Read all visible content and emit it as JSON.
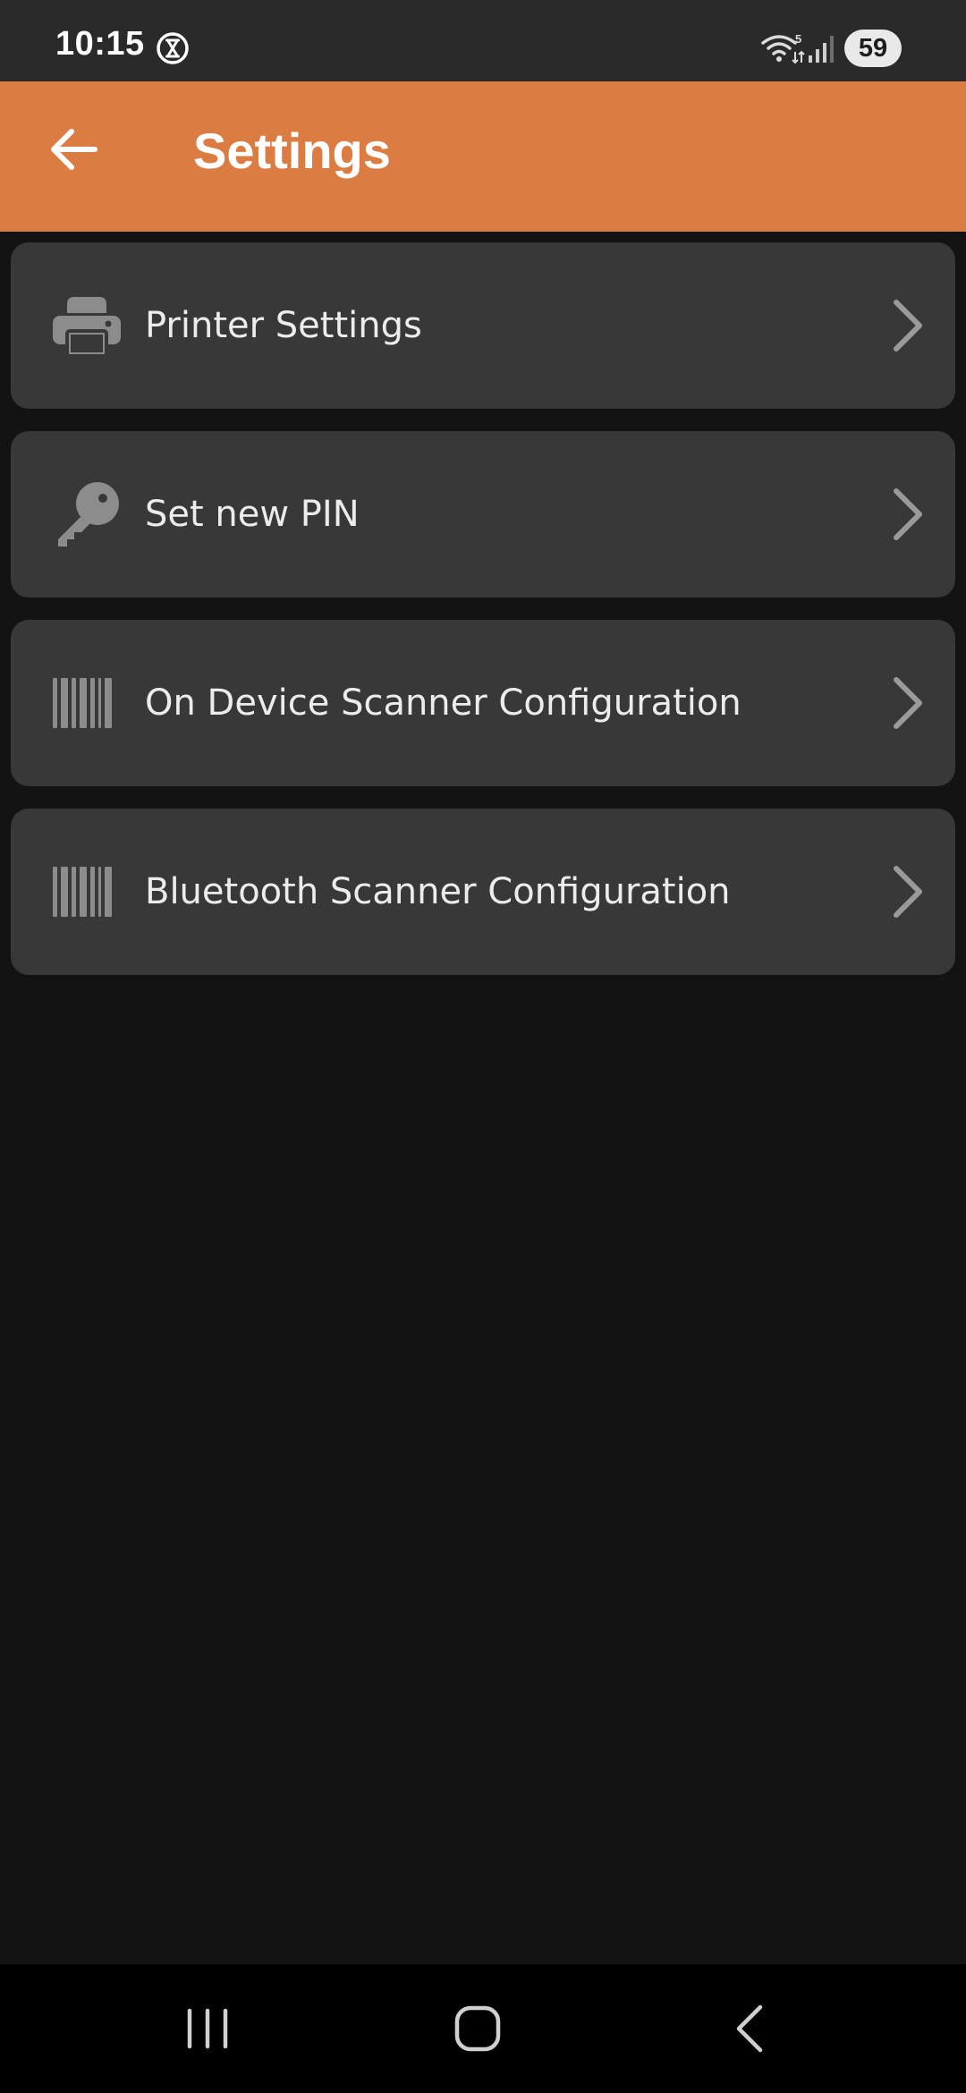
{
  "status_bar": {
    "time": "10:15",
    "battery": "59",
    "icons": [
      "timer-icon",
      "wifi-icon",
      "signal-icon",
      "battery-icon"
    ]
  },
  "app_bar": {
    "title": "Settings",
    "back_icon": "arrow-left-icon",
    "background_color": "#db7d42"
  },
  "settings": {
    "items": [
      {
        "label": "Printer Settings",
        "icon": "printer-icon"
      },
      {
        "label": "Set new PIN",
        "icon": "key-icon"
      },
      {
        "label": "On Device Scanner Configuration",
        "icon": "barcode-icon"
      },
      {
        "label": "Bluetooth Scanner Configuration",
        "icon": "barcode-icon"
      }
    ]
  },
  "nav_bar": {
    "buttons": [
      "recents-icon",
      "home-icon",
      "back-icon"
    ]
  }
}
